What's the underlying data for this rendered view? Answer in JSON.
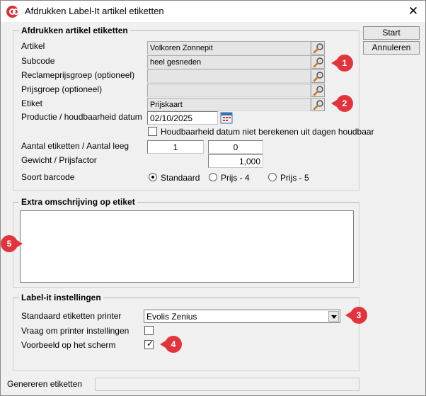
{
  "window": {
    "title": "Afdrukken Label-It artikel etiketten",
    "close_symbol": "✕"
  },
  "buttons": {
    "start": "Start",
    "cancel": "Annuleren"
  },
  "group1": {
    "title": "Afdrukken artikel etiketten",
    "fields": {
      "artikel": {
        "label": "Artikel",
        "value": "Volkoren Zonnepit"
      },
      "subcode": {
        "label": "Subcode",
        "value": "heel gesneden"
      },
      "reclame": {
        "label": "Reclameprijsgroep (optioneel)",
        "value": ""
      },
      "prijsgroep": {
        "label": "Prijsgroep (optioneel)",
        "value": ""
      },
      "etiket": {
        "label": "Etiket",
        "value": "Prijskaart"
      }
    },
    "productie": {
      "label": "Productie / houdbaarheid datum",
      "value": "02/10/2025"
    },
    "checkbox_houdbaar": {
      "label": "Houdbaarheid datum niet berekenen uit dagen houdbaar",
      "checked": false
    },
    "aantal": {
      "label": "Aantal etiketten / Aantal leeg",
      "value1": "1",
      "value2": "0"
    },
    "gewicht": {
      "label": "Gewicht / Prijsfactor",
      "value": "1,000"
    },
    "barcode": {
      "label": "Soort barcode",
      "options": [
        "Standaard",
        "Prijs - 4",
        "Prijs - 5"
      ],
      "selected": "Standaard"
    }
  },
  "group2": {
    "title": "Extra omschrijving op etiket",
    "text": ""
  },
  "group3": {
    "title": "Label-it instellingen",
    "printer": {
      "label": "Standaard etiketten printer",
      "value": "Evolis Zenius"
    },
    "vraag": {
      "label": "Vraag om printer instellingen",
      "checked": false
    },
    "voorbeeld": {
      "label": "Voorbeeld op het scherm",
      "checked": true
    }
  },
  "status": {
    "label": "Genereren etiketten",
    "value": ""
  },
  "callouts": [
    "1",
    "2",
    "3",
    "4",
    "5"
  ],
  "icons": {
    "lookup": "magnifier-icon",
    "calendar": "calendar-icon",
    "app": "app-logo-icon"
  },
  "colors": {
    "callout": "#e0353d",
    "app_icon": "#d1343a"
  }
}
